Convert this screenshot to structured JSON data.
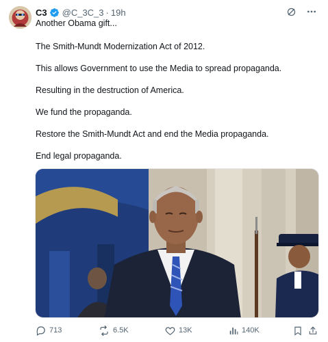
{
  "tweet": {
    "author": {
      "display_name": "C3",
      "handle": "@C_3C_3",
      "separator": "·",
      "time": "19h",
      "verified": true
    },
    "text_lines": [
      "Another Obama gift...",
      "The Smith-Mundt Modernization Act of 2012.",
      "This allows Government to use the Media to spread propaganda.",
      "Resulting in the destruction of America.",
      "We fund the propaganda.",
      "Restore the Smith-Mundt Act and end the Media propaganda.",
      "End legal propaganda."
    ],
    "actions": {
      "replies": "713",
      "reposts": "6.5K",
      "likes": "13K",
      "views": "140K"
    }
  },
  "icons": {
    "verified": "verified-badge-icon",
    "grok": "grok-icon",
    "more": "more-icon",
    "reply": "reply-icon",
    "repost": "repost-icon",
    "like": "like-icon",
    "views": "views-icon",
    "bookmark": "bookmark-icon",
    "share": "share-icon"
  },
  "colors": {
    "text": "#0f1419",
    "secondary": "#536471",
    "verified": "#1d9bf0"
  }
}
